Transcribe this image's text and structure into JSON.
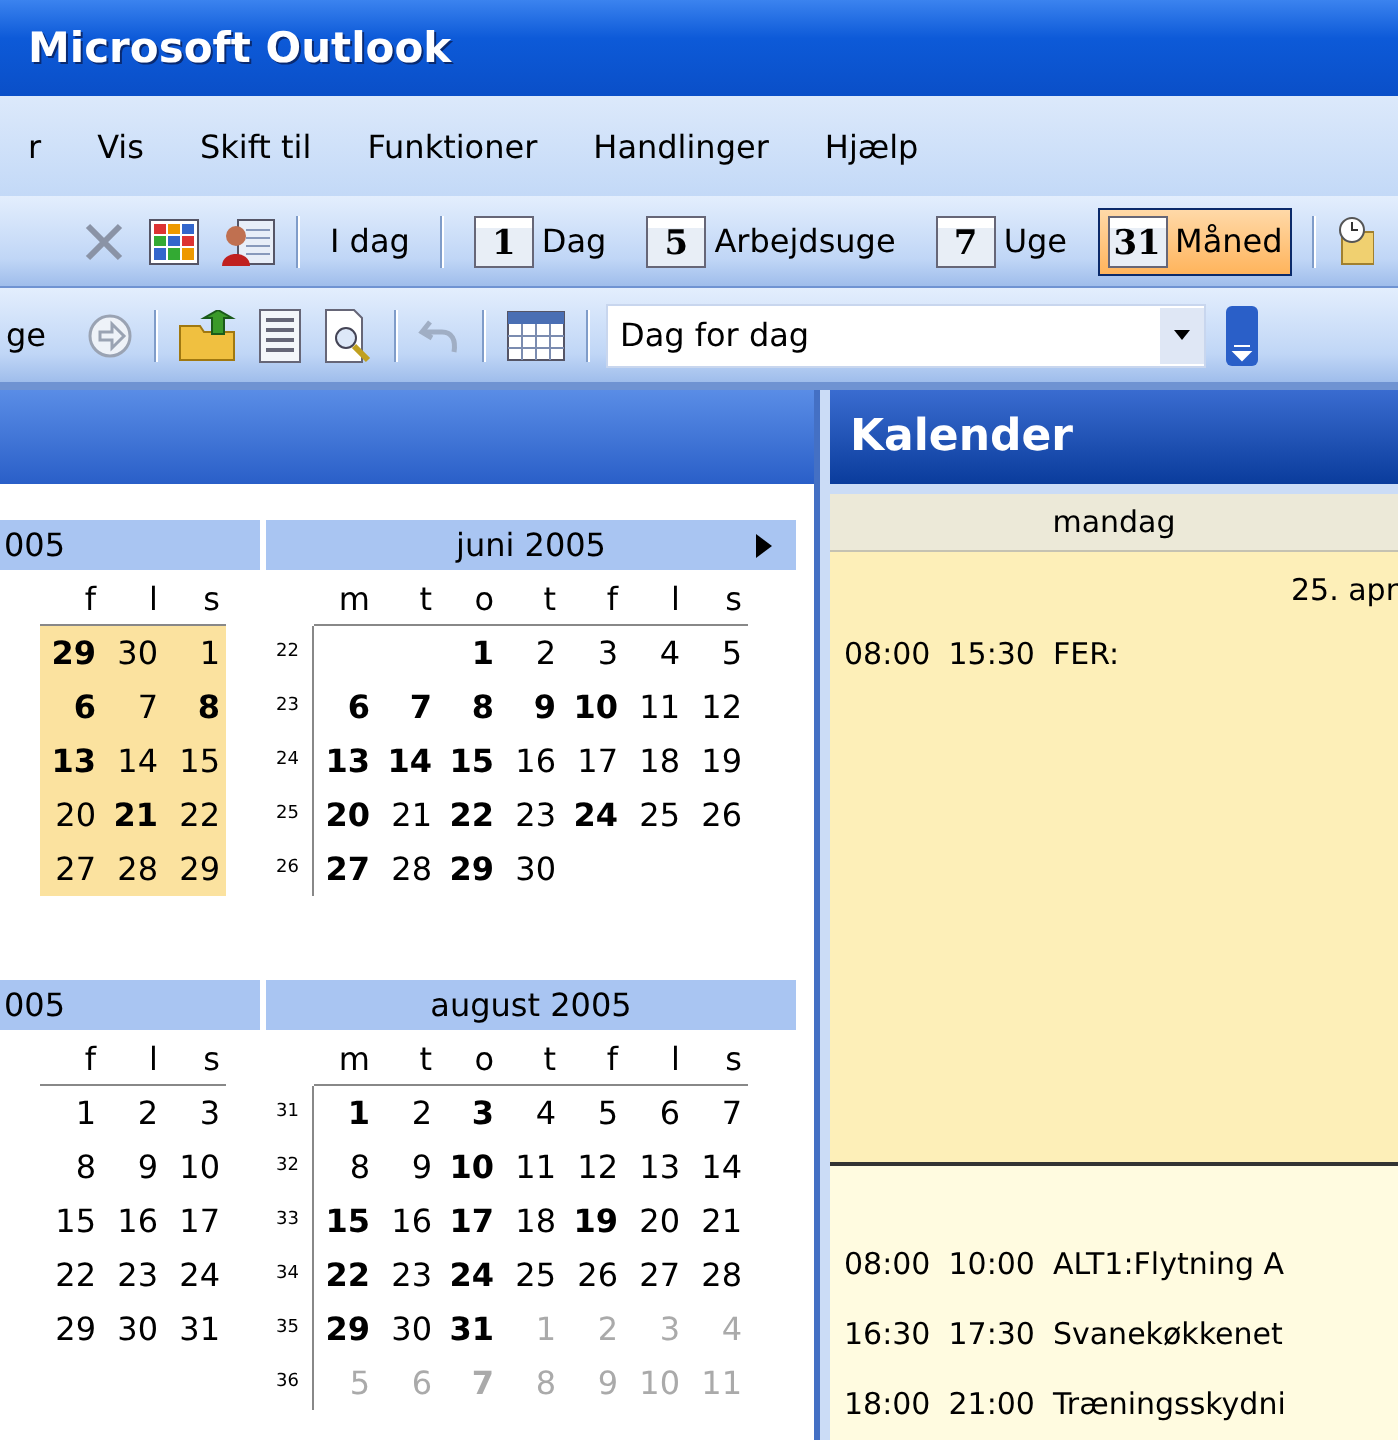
{
  "window": {
    "title": "Microsoft Outlook"
  },
  "menu": [
    "r",
    "Vis",
    "Skift til",
    "Funktioner",
    "Handlinger",
    "Hjælp"
  ],
  "toolbar": [
    {
      "kind": "delete"
    },
    {
      "kind": "grid"
    },
    {
      "kind": "contact"
    },
    {
      "kind": "separator"
    },
    {
      "kind": "button",
      "label": "I dag"
    },
    {
      "kind": "separator"
    },
    {
      "kind": "view",
      "label": "Dag",
      "number": "1",
      "selected": false
    },
    {
      "kind": "view",
      "label": "Arbejdsuge",
      "number": "5",
      "selected": false
    },
    {
      "kind": "view",
      "label": "Uge",
      "number": "7",
      "selected": false
    },
    {
      "kind": "view",
      "label": "Måned",
      "number": "31",
      "selected": true
    },
    {
      "kind": "separator"
    },
    {
      "kind": "clock"
    }
  ],
  "toolbar_2": [
    {
      "kind": "button",
      "label": "ge"
    },
    {
      "kind": "forward"
    },
    {
      "kind": "separator"
    },
    {
      "kind": "folder"
    },
    {
      "kind": "list"
    },
    {
      "kind": "preview"
    },
    {
      "kind": "separator"
    },
    {
      "kind": "undo"
    },
    {
      "kind": "separator"
    },
    {
      "kind": "calgrid"
    },
    {
      "kind": "separator"
    },
    {
      "kind": "dropdown",
      "value": "Dag for dag"
    },
    {
      "kind": "overflow"
    }
  ],
  "navigation": {
    "months": [
      {
        "title": "005",
        "next_arrow": false,
        "highlighted": true,
        "weekdays": [
          "f",
          "l",
          "s"
        ],
        "weeks": [
          {
            "days": [
              {
                "d": "29",
                "bold": true,
                "muted": false
              },
              {
                "d": "30",
                "bold": false,
                "muted": false
              },
              {
                "d": "1",
                "bold": false,
                "muted": false
              }
            ]
          },
          {
            "days": [
              {
                "d": "6",
                "bold": true,
                "muted": false
              },
              {
                "d": "7",
                "bold": false,
                "muted": false
              },
              {
                "d": "8",
                "bold": true,
                "muted": false
              }
            ]
          },
          {
            "days": [
              {
                "d": "13",
                "bold": true,
                "muted": false
              },
              {
                "d": "14",
                "bold": false,
                "muted": false
              },
              {
                "d": "15",
                "bold": false,
                "muted": false
              }
            ]
          },
          {
            "days": [
              {
                "d": "20",
                "bold": false,
                "muted": false
              },
              {
                "d": "21",
                "bold": true,
                "muted": false
              },
              {
                "d": "22",
                "bold": false,
                "muted": false
              }
            ]
          },
          {
            "days": [
              {
                "d": "27",
                "bold": false,
                "muted": false
              },
              {
                "d": "28",
                "bold": false,
                "muted": false
              },
              {
                "d": "29",
                "bold": false,
                "muted": false
              }
            ]
          }
        ]
      },
      {
        "title": "juni 2005",
        "next_arrow": true,
        "highlighted": false,
        "weekdays": [
          "m",
          "t",
          "o",
          "t",
          "f",
          "l",
          "s"
        ],
        "weeks": [
          {
            "week": "22",
            "days": [
              {
                "d": "1",
                "bold": true,
                "muted": false
              },
              {
                "d": "2",
                "bold": false,
                "muted": false
              },
              {
                "d": "3",
                "bold": false,
                "muted": false
              },
              {
                "d": "4",
                "bold": false,
                "muted": false
              },
              {
                "d": "5",
                "bold": false,
                "muted": false
              }
            ]
          },
          {
            "week": "23",
            "days": [
              {
                "d": "6",
                "bold": true,
                "muted": false
              },
              {
                "d": "7",
                "bold": true,
                "muted": false
              },
              {
                "d": "8",
                "bold": true,
                "muted": false
              },
              {
                "d": "9",
                "bold": true,
                "muted": false
              },
              {
                "d": "10",
                "bold": true,
                "muted": false
              },
              {
                "d": "11",
                "bold": false,
                "muted": false
              },
              {
                "d": "12",
                "bold": false,
                "muted": false
              }
            ]
          },
          {
            "week": "24",
            "days": [
              {
                "d": "13",
                "bold": true,
                "muted": false
              },
              {
                "d": "14",
                "bold": true,
                "muted": false
              },
              {
                "d": "15",
                "bold": true,
                "muted": false
              },
              {
                "d": "16",
                "bold": false,
                "muted": false
              },
              {
                "d": "17",
                "bold": false,
                "muted": false
              },
              {
                "d": "18",
                "bold": false,
                "muted": false
              },
              {
                "d": "19",
                "bold": false,
                "muted": false
              }
            ]
          },
          {
            "week": "25",
            "days": [
              {
                "d": "20",
                "bold": true,
                "muted": false
              },
              {
                "d": "21",
                "bold": false,
                "muted": false
              },
              {
                "d": "22",
                "bold": true,
                "muted": false
              },
              {
                "d": "23",
                "bold": false,
                "muted": false
              },
              {
                "d": "24",
                "bold": true,
                "muted": false
              },
              {
                "d": "25",
                "bold": false,
                "muted": false
              },
              {
                "d": "26",
                "bold": false,
                "muted": false
              }
            ]
          },
          {
            "week": "26",
            "days": [
              {
                "d": "27",
                "bold": true,
                "muted": false
              },
              {
                "d": "28",
                "bold": false,
                "muted": false
              },
              {
                "d": "29",
                "bold": true,
                "muted": false
              },
              {
                "d": "30",
                "bold": false,
                "muted": false
              }
            ]
          }
        ]
      },
      {
        "title": "005",
        "next_arrow": false,
        "highlighted": false,
        "weekdays": [
          "f",
          "l",
          "s"
        ],
        "weeks": [
          {
            "days": [
              {
                "d": "1",
                "bold": false,
                "muted": false
              },
              {
                "d": "2",
                "bold": false,
                "muted": false
              },
              {
                "d": "3",
                "bold": false,
                "muted": false
              }
            ]
          },
          {
            "days": [
              {
                "d": "8",
                "bold": false,
                "muted": false
              },
              {
                "d": "9",
                "bold": false,
                "muted": false
              },
              {
                "d": "10",
                "bold": false,
                "muted": false
              }
            ]
          },
          {
            "days": [
              {
                "d": "15",
                "bold": false,
                "muted": false
              },
              {
                "d": "16",
                "bold": false,
                "muted": false
              },
              {
                "d": "17",
                "bold": false,
                "muted": false
              }
            ]
          },
          {
            "days": [
              {
                "d": "22",
                "bold": false,
                "muted": false
              },
              {
                "d": "23",
                "bold": false,
                "muted": false
              },
              {
                "d": "24",
                "bold": false,
                "muted": false
              }
            ]
          },
          {
            "days": [
              {
                "d": "29",
                "bold": false,
                "muted": false
              },
              {
                "d": "30",
                "bold": false,
                "muted": false
              },
              {
                "d": "31",
                "bold": false,
                "muted": false
              }
            ]
          }
        ]
      },
      {
        "title": "august 2005",
        "next_arrow": false,
        "highlighted": false,
        "weekdays": [
          "m",
          "t",
          "o",
          "t",
          "f",
          "l",
          "s"
        ],
        "weeks": [
          {
            "week": "31",
            "days": [
              {
                "d": "1",
                "bold": true,
                "muted": false
              },
              {
                "d": "2",
                "bold": false,
                "muted": false
              },
              {
                "d": "3",
                "bold": true,
                "muted": false
              },
              {
                "d": "4",
                "bold": false,
                "muted": false
              },
              {
                "d": "5",
                "bold": false,
                "muted": false
              },
              {
                "d": "6",
                "bold": false,
                "muted": false
              },
              {
                "d": "7",
                "bold": false,
                "muted": false
              }
            ]
          },
          {
            "week": "32",
            "days": [
              {
                "d": "8",
                "bold": false,
                "muted": false
              },
              {
                "d": "9",
                "bold": false,
                "muted": false
              },
              {
                "d": "10",
                "bold": true,
                "muted": false
              },
              {
                "d": "11",
                "bold": false,
                "muted": false
              },
              {
                "d": "12",
                "bold": false,
                "muted": false
              },
              {
                "d": "13",
                "bold": false,
                "muted": false
              },
              {
                "d": "14",
                "bold": false,
                "muted": false
              }
            ]
          },
          {
            "week": "33",
            "days": [
              {
                "d": "15",
                "bold": true,
                "muted": false
              },
              {
                "d": "16",
                "bold": false,
                "muted": false
              },
              {
                "d": "17",
                "bold": true,
                "muted": false
              },
              {
                "d": "18",
                "bold": false,
                "muted": false
              },
              {
                "d": "19",
                "bold": true,
                "muted": false
              },
              {
                "d": "20",
                "bold": false,
                "muted": false
              },
              {
                "d": "21",
                "bold": false,
                "muted": false
              }
            ]
          },
          {
            "week": "34",
            "days": [
              {
                "d": "22",
                "bold": true,
                "muted": false
              },
              {
                "d": "23",
                "bold": false,
                "muted": false
              },
              {
                "d": "24",
                "bold": true,
                "muted": false
              },
              {
                "d": "25",
                "bold": false,
                "muted": false
              },
              {
                "d": "26",
                "bold": false,
                "muted": false
              },
              {
                "d": "27",
                "bold": false,
                "muted": false
              },
              {
                "d": "28",
                "bold": false,
                "muted": false
              }
            ]
          },
          {
            "week": "35",
            "days": [
              {
                "d": "29",
                "bold": true,
                "muted": false
              },
              {
                "d": "30",
                "bold": false,
                "muted": false
              },
              {
                "d": "31",
                "bold": true,
                "muted": false
              },
              {
                "d": "1",
                "bold": false,
                "muted": true
              },
              {
                "d": "2",
                "bold": false,
                "muted": true
              },
              {
                "d": "3",
                "bold": false,
                "muted": true
              },
              {
                "d": "4",
                "bold": false,
                "muted": true
              }
            ]
          },
          {
            "week": "36",
            "days": [
              {
                "d": "5",
                "bold": false,
                "muted": true
              },
              {
                "d": "6",
                "bold": false,
                "muted": true
              },
              {
                "d": "7",
                "bold": true,
                "muted": true
              },
              {
                "d": "8",
                "bold": false,
                "muted": true
              },
              {
                "d": "9",
                "bold": false,
                "muted": true
              },
              {
                "d": "10",
                "bold": false,
                "muted": true
              },
              {
                "d": "11",
                "bold": false,
                "muted": true
              }
            ]
          }
        ]
      }
    ]
  },
  "calendar": {
    "title": "Kalender",
    "day_header": "mandag",
    "days": [
      {
        "selected": true,
        "date": "25. apr",
        "events": [
          {
            "start": "08:00",
            "end": "15:30",
            "subject": "FER:"
          }
        ]
      },
      {
        "selected": false,
        "events": [
          {
            "start": "08:00",
            "end": "10:00",
            "subject": "ALT1:Flytning A"
          },
          {
            "start": "16:30",
            "end": "17:30",
            "subject": "Svanekøkkenet"
          },
          {
            "start": "18:00",
            "end": "21:00",
            "subject": "Træningsskydni"
          }
        ]
      }
    ]
  }
}
